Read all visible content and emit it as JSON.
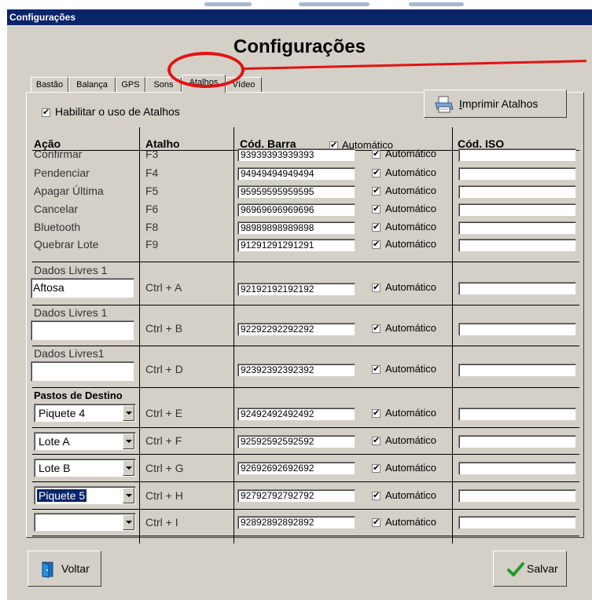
{
  "window": {
    "title": "Configurações"
  },
  "page_title": "Configurações",
  "tabs": [
    {
      "label": "Bastão"
    },
    {
      "label": "Balança"
    },
    {
      "label": "GPS"
    },
    {
      "label": "Sons"
    },
    {
      "label": "Atalhos",
      "active": true
    },
    {
      "label": "Vídeo"
    }
  ],
  "enable_label": "Habilitar o uso de Atalhos",
  "enable_checked": true,
  "print_button": "Imprimir Atalhos",
  "columns": {
    "acao": "Ação",
    "atalho": "Atalho",
    "cod_barra": "Cód. Barra",
    "auto_all": "Automático",
    "cod_iso": "Cód. ISO"
  },
  "auto_label": "Automático",
  "rows": [
    {
      "acao": "Confirmar",
      "atalho": "F3",
      "barcode": "93939393939393",
      "auto": true,
      "iso": ""
    },
    {
      "acao": "Pendenciar",
      "atalho": "F4",
      "barcode": "94949494949494",
      "auto": true,
      "iso": ""
    },
    {
      "acao": "Apagar Última",
      "atalho": "F5",
      "barcode": "95959595959595",
      "auto": true,
      "iso": ""
    },
    {
      "acao": "Cancelar",
      "atalho": "F6",
      "barcode": "96969696969696",
      "auto": true,
      "iso": ""
    },
    {
      "acao": "Bluetooth",
      "atalho": "F8",
      "barcode": "98989898989898",
      "auto": true,
      "iso": ""
    },
    {
      "acao": "Quebrar Lote",
      "atalho": "F9",
      "barcode": "91291291291291",
      "auto": true,
      "iso": ""
    }
  ],
  "free_rows": [
    {
      "label": "Dados Livres 1",
      "value": "Aftosa",
      "atalho": "Ctrl + A",
      "barcode": "92192192192192",
      "auto": true,
      "iso": ""
    },
    {
      "label": "Dados Livres 1",
      "value": "",
      "atalho": "Ctrl + B",
      "barcode": "92292292292292",
      "auto": true,
      "iso": ""
    },
    {
      "label": "Dados Livres1",
      "value": "",
      "atalho": "Ctrl + D",
      "barcode": "92392392392392",
      "auto": true,
      "iso": ""
    }
  ],
  "pastos_label": "Pastos de Destino",
  "pasto_rows": [
    {
      "value": "Piquete 4",
      "atalho": "Ctrl + E",
      "barcode": "92492492492492",
      "auto": true,
      "iso": ""
    },
    {
      "value": "Lote A",
      "atalho": "Ctrl + F",
      "barcode": "92592592592592",
      "auto": true,
      "iso": ""
    },
    {
      "value": "Lote B",
      "atalho": "Ctrl + G",
      "barcode": "92692692692692",
      "auto": true,
      "iso": ""
    },
    {
      "value": "Piquete 5",
      "atalho": "Ctrl + H",
      "barcode": "92792792792792",
      "auto": true,
      "iso": "",
      "selected": true
    },
    {
      "value": "",
      "atalho": "Ctrl + I",
      "barcode": "92892892892892",
      "auto": true,
      "iso": ""
    }
  ],
  "buttons": {
    "back": "Voltar",
    "save": "Salvar"
  },
  "colors": {
    "titlebar": "#0a246a",
    "face": "#d4d0c8",
    "highlight_annotation": "#e31212",
    "selection": "#0a246a"
  },
  "icons": {
    "print": "printer-icon",
    "back": "door-exit-icon",
    "save": "checkmark-icon"
  }
}
